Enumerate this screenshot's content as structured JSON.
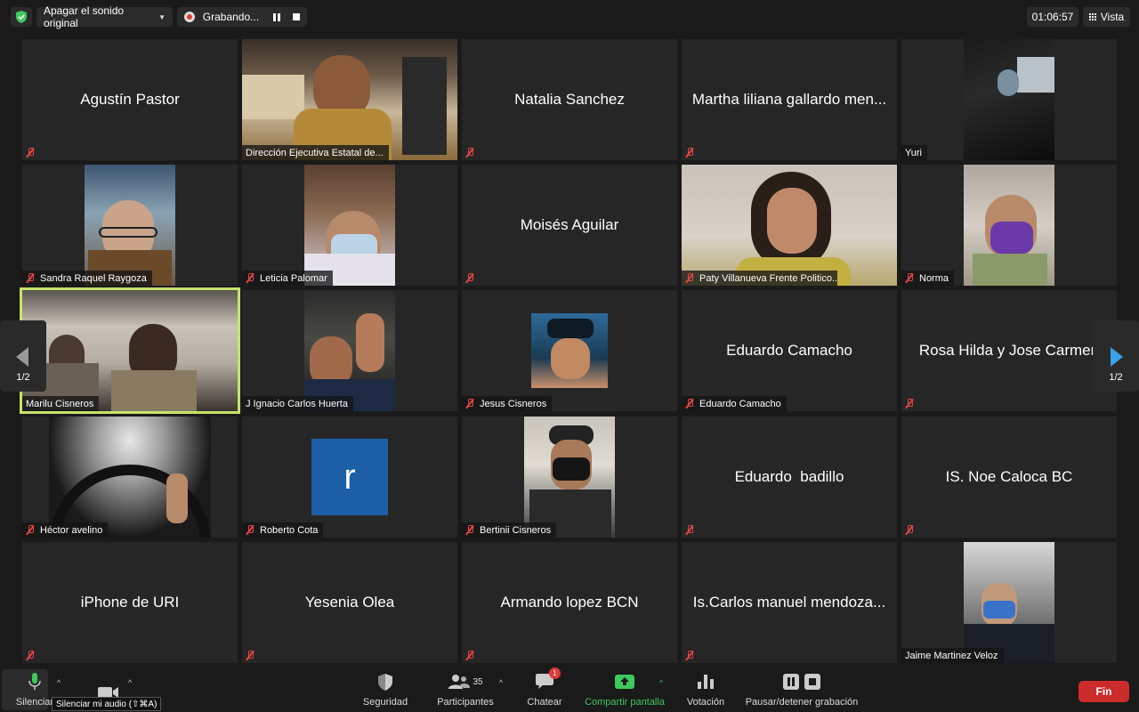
{
  "topbar": {
    "audio_pill": "Apagar el sonido original",
    "recording": "Grabando...",
    "time": "01:06:57",
    "view": "Vista"
  },
  "tiles": [
    {
      "name": "Agustín Pastor",
      "center": true,
      "muted": true
    },
    {
      "name": "Dirección Ejecutiva Estatal de...",
      "center": false,
      "muted": false,
      "video": "bright-office"
    },
    {
      "name": "Natalia Sanchez",
      "center": true,
      "muted": true
    },
    {
      "name": "Martha liliana gallardo men...",
      "center": true,
      "muted": true
    },
    {
      "name": "Yuri",
      "center": false,
      "muted": false,
      "video": "car-dark"
    },
    {
      "name": "Sandra Raquel Raygoza",
      "center": false,
      "muted": true,
      "video": "woman-glasses"
    },
    {
      "name": "Leticia Palomar",
      "center": false,
      "muted": true,
      "video": "woman-mask"
    },
    {
      "name": "Moisés Aguilar",
      "center": true,
      "muted": true
    },
    {
      "name": "Paty Villanueva Frente Politico...",
      "center": false,
      "muted": true,
      "video": "woman-yellow"
    },
    {
      "name": "Norma",
      "center": false,
      "muted": true,
      "video": "car-purple"
    },
    {
      "name": "Marilu Cisneros",
      "center": false,
      "muted": false,
      "active": true,
      "video": "room-window"
    },
    {
      "name": "J Ignacio Carlos Huerta",
      "center": false,
      "muted": false,
      "video": "man-wave"
    },
    {
      "name": "Jesus Cisneros",
      "center": false,
      "muted": true,
      "video": "profile-photo"
    },
    {
      "name": "Eduardo Camacho",
      "center": true,
      "muted": true,
      "label": "Eduardo Camacho"
    },
    {
      "name": "Rosa Hilda y Jose Carmen",
      "center": true,
      "muted": true
    },
    {
      "name": "Héctor avelino",
      "center": false,
      "muted": true,
      "video": "steering"
    },
    {
      "name": "Roberto Cota",
      "center": false,
      "muted": true,
      "avatar_letter": "r"
    },
    {
      "name": "Bertinii Cisneros",
      "center": false,
      "muted": true,
      "video": "man-mask"
    },
    {
      "name": "Eduardo  badillo",
      "center": true,
      "muted": true
    },
    {
      "name": "IS. Noe Caloca BC",
      "center": true,
      "muted": true
    },
    {
      "name": "iPhone de URI",
      "center": true,
      "muted": true
    },
    {
      "name": "Yesenia Olea",
      "center": true,
      "muted": true
    },
    {
      "name": "Armando lopez BCN",
      "center": true,
      "muted": true
    },
    {
      "name": "Is.Carlos manuel mendoza...",
      "center": true,
      "muted": true
    },
    {
      "name": "Jaime Martinez Veloz",
      "center": false,
      "muted": false,
      "video": "man-blue-mask"
    }
  ],
  "nav": {
    "left_page": "1/2",
    "right_page": "1/2"
  },
  "toolbar": {
    "mute_label": "Silenciar",
    "tooltip": "Silenciar mi audio (⇧⌘A)",
    "security": "Seguridad",
    "participants": "Participantes",
    "participants_count": "35",
    "chat": "Chatear",
    "chat_badge": "1",
    "share": "Compartir pantalla",
    "poll": "Votación",
    "record": "Pausar/detener grabación",
    "end": "Fin"
  },
  "colors": {
    "active_speaker": "#c6e36b",
    "end_button": "#cc2b2b",
    "share_green": "#3ec95c",
    "muted_red": "#e64545"
  }
}
